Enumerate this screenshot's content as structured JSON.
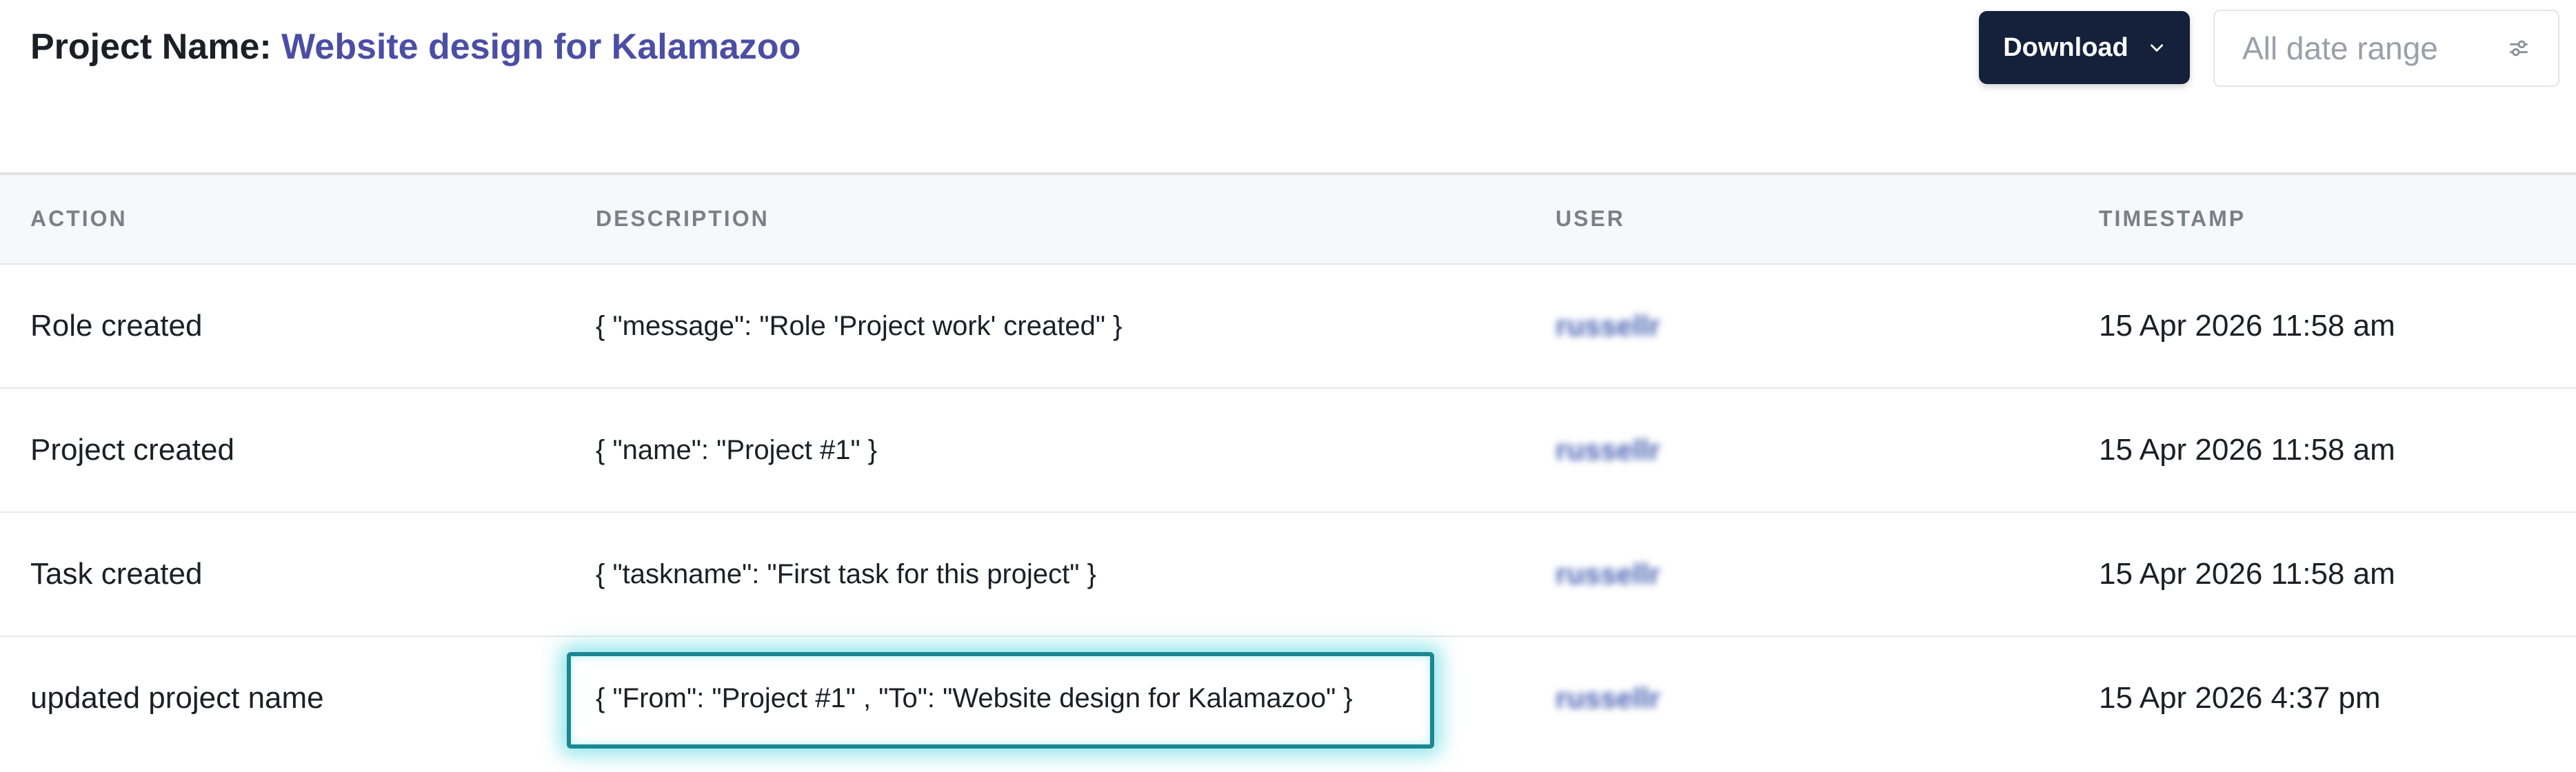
{
  "header": {
    "title_label": "Project Name:",
    "project_name": "Website design for Kalamazoo",
    "download_label": "Download",
    "date_range_placeholder": "All date range"
  },
  "table": {
    "columns": [
      "ACTION",
      "DESCRIPTION",
      "USER",
      "TIMESTAMP"
    ],
    "rows": [
      {
        "action": "Role created",
        "description": "{   \"message\": \"Role 'Project work' created\" }",
        "user": "russellr",
        "timestamp": "15 Apr 2026 11:58 am"
      },
      {
        "action": "Project created",
        "description": "{   \"name\": \"Project #1\" }",
        "user": "russellr",
        "timestamp": "15 Apr 2026 11:58 am"
      },
      {
        "action": "Task created",
        "description": "{   \"taskname\": \"First task for this project\" }",
        "user": "russellr",
        "timestamp": "15 Apr 2026 11:58 am"
      },
      {
        "action": "updated project name",
        "description": "{   \"From\": \"Project #1\" ,   \"To\": \"Website design for Kalamazoo\" }",
        "user": "russellr",
        "timestamp": "15 Apr 2026 4:37 pm"
      }
    ]
  },
  "colors": {
    "title_accent": "#4b4ea5",
    "button_bg": "#15213b",
    "highlight_border": "#1b8791",
    "highlight_glow": "#3cd2dc"
  },
  "icons": {
    "download_chevron": "chevron-down-icon",
    "date_range_control": "sliders-icon"
  }
}
